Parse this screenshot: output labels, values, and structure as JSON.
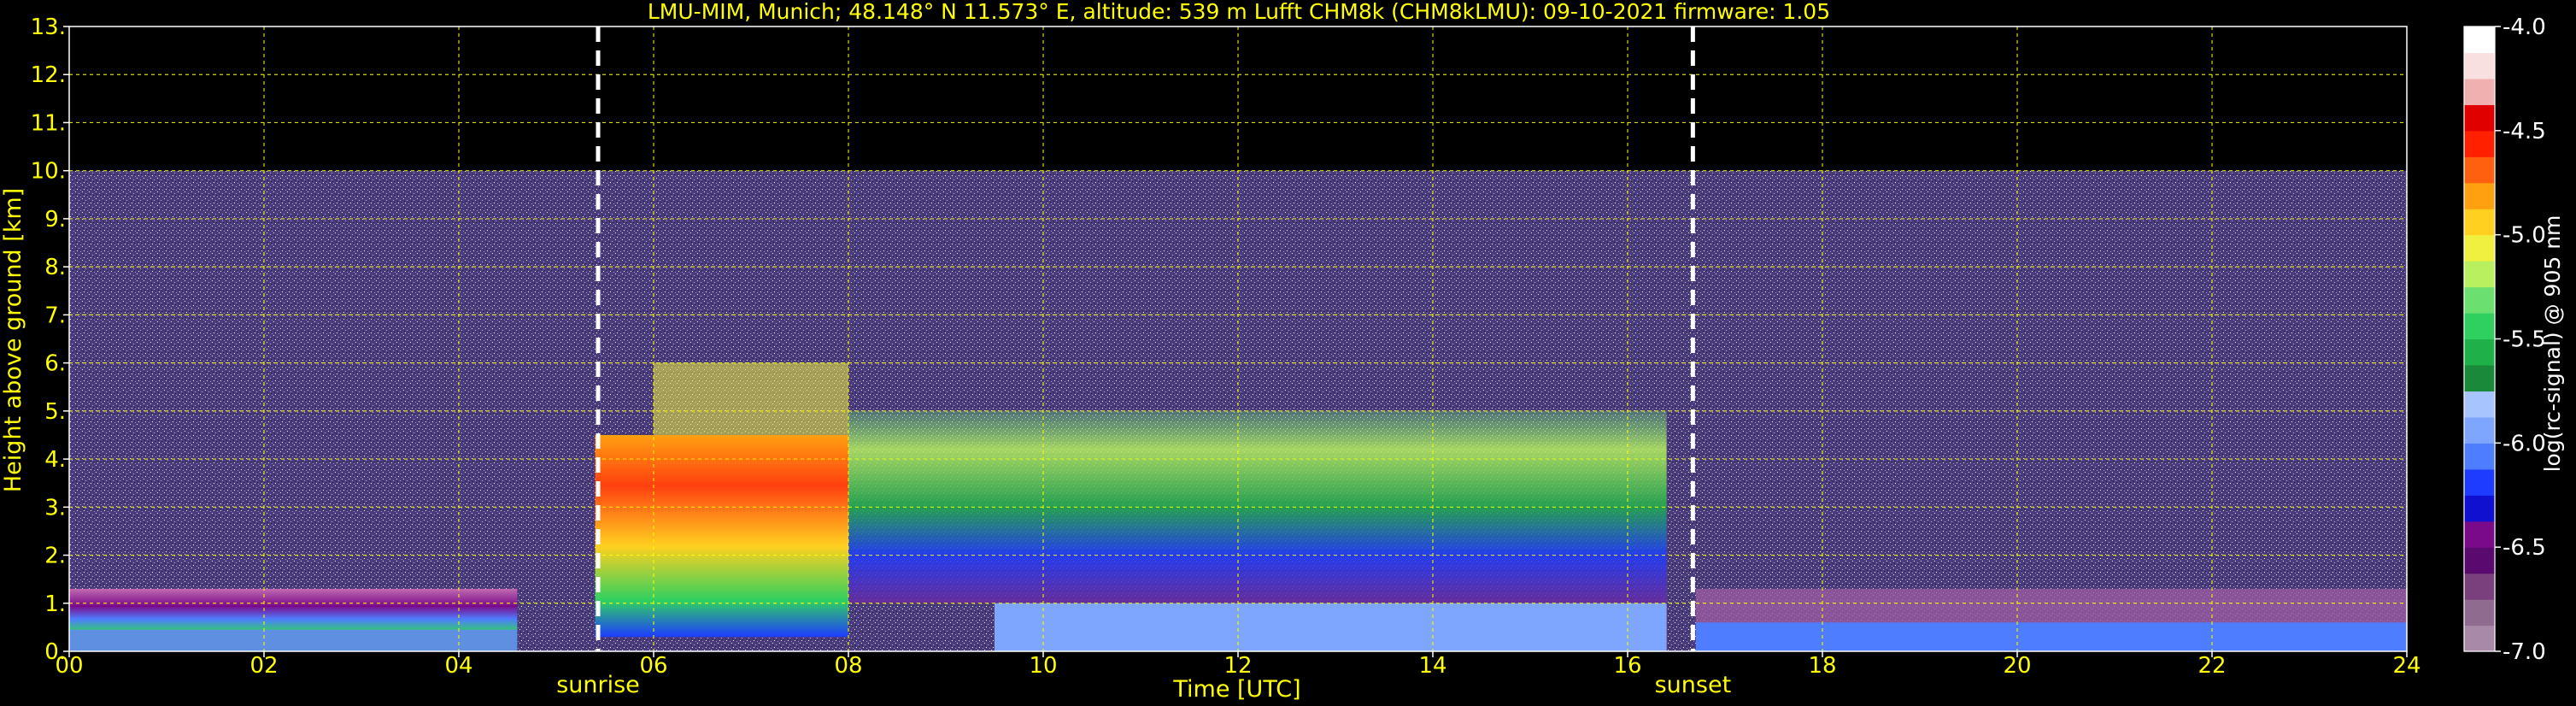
{
  "chart_data": {
    "type": "heatmap",
    "title": "LMU-MIM, Munich; 48.148° N 11.573° E, altitude: 539 m    Lufft CHM8k (CHM8kLMU): 09-10-2021    firmware: 1.05",
    "xlabel": "Time [UTC]",
    "ylabel": "Height above ground [km]",
    "xlim": [
      0,
      24
    ],
    "ylim": [
      0,
      13
    ],
    "x_tick_labels": [
      "00",
      "02",
      "04",
      "06",
      "08",
      "10",
      "12",
      "14",
      "16",
      "18",
      "20",
      "22",
      "24"
    ],
    "y_tick_labels": [
      "0.",
      "1.",
      "2.",
      "3.",
      "4.",
      "5.",
      "6.",
      "7.",
      "8.",
      "9.",
      "10.",
      "11.",
      "12.",
      "13."
    ],
    "grid": true,
    "grid_color": "#ffff00",
    "data_max_height_km": 10,
    "events": [
      {
        "label": "sunrise",
        "time_utc": 5.43
      },
      {
        "label": "sunset",
        "time_utc": 16.67
      }
    ],
    "colorbar": {
      "label": "log(rc-signal) @ 905 nm",
      "range": [
        -7.0,
        -4.0
      ],
      "tick_labels": [
        "-4.0",
        "-4.5",
        "-5.0",
        "-5.5",
        "-6.0",
        "-6.5",
        "-7.0"
      ],
      "colors": [
        "#a88aa8",
        "#8f6b90",
        "#7a3f7d",
        "#5a0a6e",
        "#7a0a8a",
        "#1010d0",
        "#1e3cff",
        "#4f7dff",
        "#7fa6ff",
        "#a7c4ff",
        "#1a8a3a",
        "#1fb04a",
        "#2fd060",
        "#6be070",
        "#b8f060",
        "#f0f040",
        "#ffd020",
        "#ffa010",
        "#ff6010",
        "#ff2000",
        "#e00000",
        "#f0b0b0",
        "#f8e0e0",
        "#ffffff"
      ]
    },
    "layers": [
      {
        "name": "background-noise",
        "t_start": 0,
        "t_end": 24,
        "h_start": 0,
        "h_end": 10,
        "color": "#5a4a8a"
      },
      {
        "name": "residual-layer-night",
        "t_start": 0,
        "t_end": 4.6,
        "h_start": 0.4,
        "h_end": 1.3,
        "color": "#8a2f8f"
      },
      {
        "name": "surface-layer-night",
        "t_start": 0,
        "t_end": 4.6,
        "h_start": 0,
        "h_end": 0.45,
        "color": "#5f8fe0"
      },
      {
        "name": "convective-plume",
        "t_start": 5.4,
        "t_end": 8.0,
        "h_start": 0.3,
        "h_end": 4.5,
        "color": "#ff6010"
      },
      {
        "name": "convective-plume-upper",
        "t_start": 6.0,
        "t_end": 8.0,
        "h_start": 4.5,
        "h_end": 6.0,
        "color": "#f0f040"
      },
      {
        "name": "aerosol-layer-day",
        "t_start": 8.0,
        "t_end": 16.4,
        "h_start": 1.0,
        "h_end": 5.0,
        "color": "#2fd060"
      },
      {
        "name": "boundary-layer-day",
        "t_start": 9.5,
        "t_end": 16.4,
        "h_start": 0,
        "h_end": 1.0,
        "color": "#7fa6ff"
      },
      {
        "name": "residual-layer-evening",
        "t_start": 16.7,
        "t_end": 24,
        "h_start": 0.5,
        "h_end": 1.3,
        "color": "#9a5aa0"
      },
      {
        "name": "surface-layer-evening",
        "t_start": 16.7,
        "t_end": 24,
        "h_start": 0,
        "h_end": 0.6,
        "color": "#4f7dff"
      }
    ]
  }
}
